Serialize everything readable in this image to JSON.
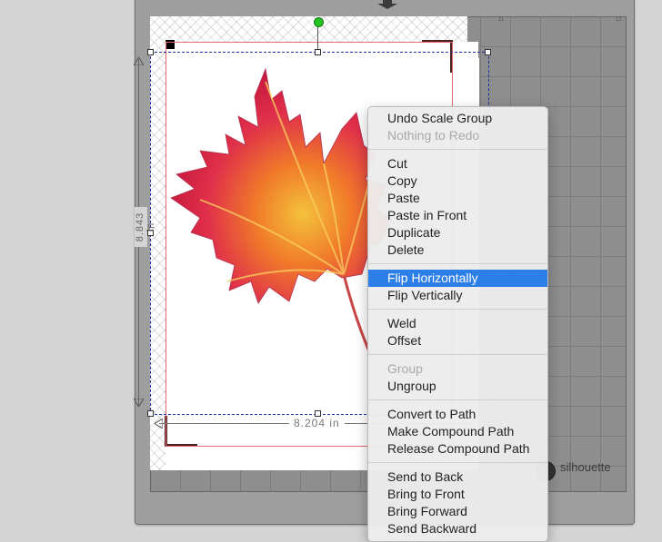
{
  "canvas": {
    "height_dimension": "8.843 in",
    "width_dimension": "8.204 in",
    "brand_label": "silhouette"
  },
  "mat": {
    "ruler_numbers": [
      "11",
      "12"
    ]
  },
  "colors": {
    "menu_highlight": "#2d7fe8",
    "cut_line": "#e06a6a",
    "selection": "#2233aa",
    "rotate_handle": "#21c221"
  },
  "context_menu": {
    "groups": [
      [
        {
          "label": "Undo Scale Group",
          "enabled": true
        },
        {
          "label": "Nothing to Redo",
          "enabled": false
        }
      ],
      [
        {
          "label": "Cut",
          "enabled": true
        },
        {
          "label": "Copy",
          "enabled": true
        },
        {
          "label": "Paste",
          "enabled": true
        },
        {
          "label": "Paste in Front",
          "enabled": true
        },
        {
          "label": "Duplicate",
          "enabled": true
        },
        {
          "label": "Delete",
          "enabled": true
        }
      ],
      [
        {
          "label": "Flip Horizontally",
          "enabled": true,
          "highlighted": true
        },
        {
          "label": "Flip Vertically",
          "enabled": true
        }
      ],
      [
        {
          "label": "Weld",
          "enabled": true
        },
        {
          "label": "Offset",
          "enabled": true
        }
      ],
      [
        {
          "label": "Group",
          "enabled": false
        },
        {
          "label": "Ungroup",
          "enabled": true
        }
      ],
      [
        {
          "label": "Convert to Path",
          "enabled": true
        },
        {
          "label": "Make Compound Path",
          "enabled": true
        },
        {
          "label": "Release Compound Path",
          "enabled": true
        }
      ],
      [
        {
          "label": "Send to Back",
          "enabled": true
        },
        {
          "label": "Bring to Front",
          "enabled": true
        },
        {
          "label": "Bring Forward",
          "enabled": true
        },
        {
          "label": "Send Backward",
          "enabled": true
        }
      ]
    ]
  }
}
